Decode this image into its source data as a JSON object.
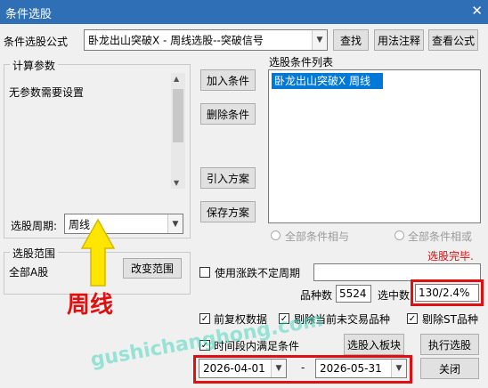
{
  "window": {
    "title": "条件选股",
    "close_glyph": "✕"
  },
  "formula": {
    "label": "条件选股公式",
    "value": "卧龙出山突破X  -  周线选股--突破信号",
    "find_button": "查找",
    "usage_button": "用法注释",
    "view_button": "查看公式"
  },
  "params": {
    "group_title": "计算参数",
    "text": "无参数需要设置",
    "period_label": "选股周期:",
    "period_value": "周线"
  },
  "conditions": {
    "list_title": "选股条件列表",
    "items": [
      "卧龙出山突破X  周线"
    ],
    "add_button": "加入条件",
    "delete_button": "删除条件",
    "import_button": "引入方案",
    "save_button": "保存方案",
    "radio_and": "全部条件相与",
    "radio_or": "全部条件相或"
  },
  "status": {
    "done_text": "选股完毕.",
    "done_color": "#e01010"
  },
  "range": {
    "group_title": "选股范围",
    "value": "全部A股",
    "change_button": "改变范围"
  },
  "options": {
    "variable_period": "使用涨跌不定周期",
    "count_label": "品种数",
    "count_value": "5524",
    "selected_label": "选中数",
    "selected_value": "130/2.4%",
    "adjust": "前复权数据",
    "exclude_untraded": "剔除当前未交易品种",
    "exclude_st": "剔除ST品种",
    "time_condition": "时间段内满足条件",
    "to_block_button": "选股入板块",
    "execute_button": "执行选股",
    "date_from": "2026-04-01",
    "date_sep": "-",
    "date_to": "2026-05-31",
    "close_button": "关闭"
  },
  "annotation": {
    "text": "周线",
    "color": "#e01010",
    "arrow_color": "#ffe600"
  },
  "watermark": "gushichanghong.com",
  "icons": {
    "dropdown": "chevron-down-icon",
    "arrow": "arrow-icon",
    "check": "checkmark-icon"
  }
}
